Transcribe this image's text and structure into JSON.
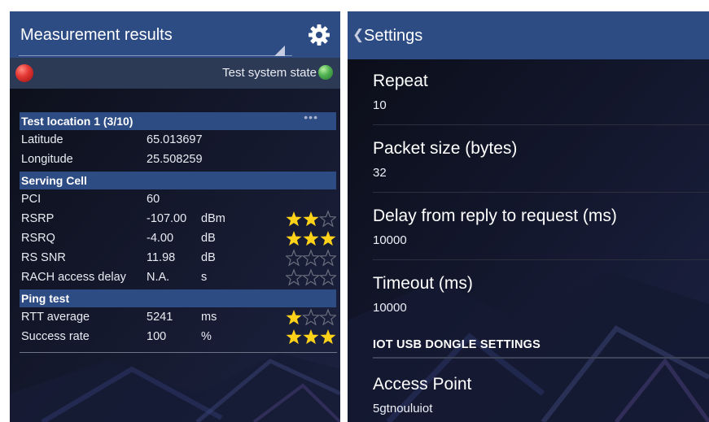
{
  "left": {
    "title": "Measurement results",
    "test_system_state_label": "Test system state",
    "colors": {
      "header": "#2e4c84",
      "status_bad": "#e53935",
      "status_ok": "#4caf50",
      "star": "#ffd21a"
    },
    "sections": {
      "location": {
        "title": "Test location 1 (3/10)",
        "more": "•••",
        "rows": [
          {
            "label": "Latitude",
            "value": "65.013697"
          },
          {
            "label": "Longitude",
            "value": "25.508259"
          }
        ]
      },
      "serving_cell": {
        "title": "Serving Cell",
        "rows": [
          {
            "label": "PCI",
            "value": "60",
            "unit": "",
            "stars": null
          },
          {
            "label": "RSRP",
            "value": "-107.00",
            "unit": "dBm",
            "stars": 2
          },
          {
            "label": "RSRQ",
            "value": "-4.00",
            "unit": "dB",
            "stars": 3
          },
          {
            "label": "RS SNR",
            "value": "11.98",
            "unit": "dB",
            "stars": 0
          },
          {
            "label": "RACH access delay",
            "value": "N.A.",
            "unit": "s",
            "stars": 0
          }
        ]
      },
      "ping_test": {
        "title": "Ping test",
        "rows": [
          {
            "label": "RTT average",
            "value": "5241",
            "unit": "ms",
            "stars": 1
          },
          {
            "label": "Success rate",
            "value": "100",
            "unit": "%",
            "stars": 3
          }
        ]
      }
    }
  },
  "right": {
    "back_icon": "chevron-left-icon",
    "title": "Settings",
    "items": [
      {
        "title": "Repeat",
        "value": "10"
      },
      {
        "title": "Packet size (bytes)",
        "value": "32"
      },
      {
        "title": "Delay from reply to request (ms)",
        "value": "10000"
      },
      {
        "title": "Timeout (ms)",
        "value": "10000"
      }
    ],
    "category": "IOT USB DONGLE SETTINGS",
    "access_point": {
      "title": "Access Point",
      "value": "5gtnouluiot"
    }
  }
}
